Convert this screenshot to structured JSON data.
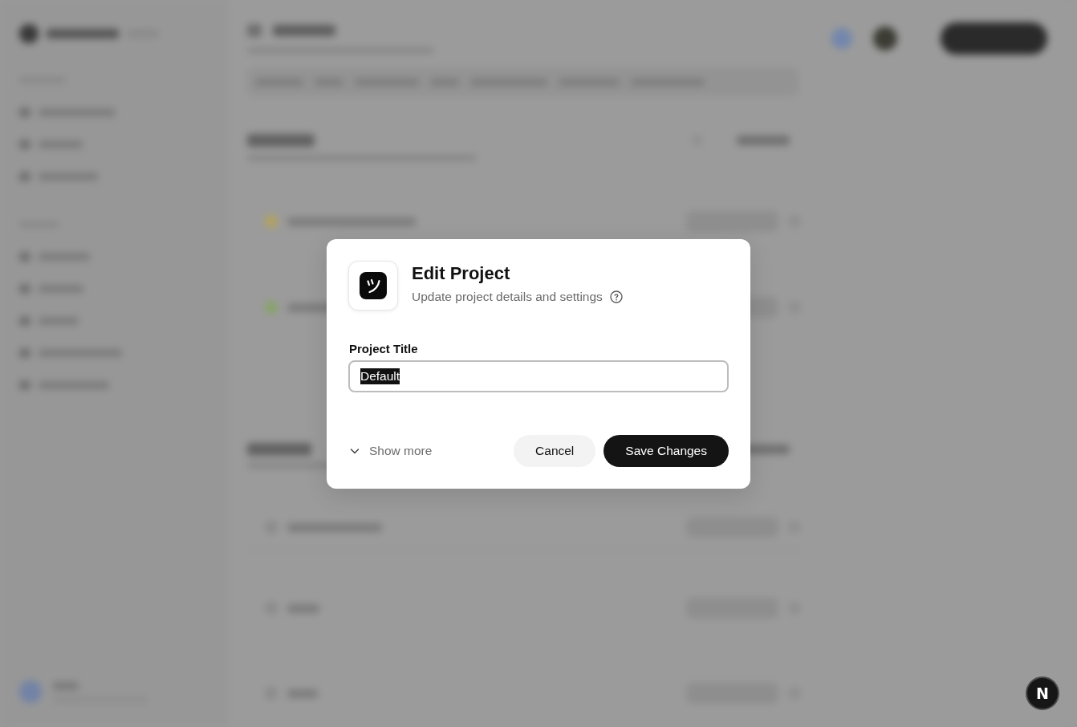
{
  "dialog": {
    "title": "Edit Project",
    "subtitle": "Update project details and settings",
    "fields": [
      {
        "label": "Project Title",
        "value": "Default",
        "focused": true,
        "text_selected": true
      }
    ],
    "show_more": {
      "label": "Show more",
      "expanded": false
    },
    "buttons": [
      {
        "kind": "secondary",
        "label": "Cancel"
      },
      {
        "kind": "primary",
        "label": "Save Changes"
      }
    ]
  },
  "dev_badge": {
    "label": "N"
  }
}
